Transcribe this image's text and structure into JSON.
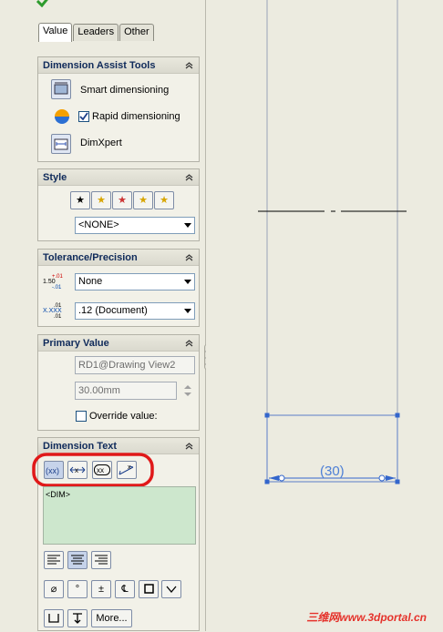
{
  "tabs": [
    {
      "label": "Value",
      "active": true
    },
    {
      "label": "Leaders",
      "active": false
    },
    {
      "label": "Other",
      "active": false
    }
  ],
  "panels": {
    "dimension_assist": {
      "title": "Dimension Assist Tools",
      "items": [
        "Smart dimensioning",
        "Rapid dimensioning",
        "DimXpert"
      ],
      "rapid_checked": true
    },
    "style": {
      "title": "Style",
      "selected": "<NONE>"
    },
    "tolerance": {
      "title": "Tolerance/Precision",
      "tolerance_type": "None",
      "precision": ".12 (Document)"
    },
    "primary_value": {
      "title": "Primary Value",
      "reference": "RD1@Drawing View2",
      "value": "30.00mm",
      "override_label": "Override value:",
      "override_checked": false
    },
    "dimension_text": {
      "title": "Dimension Text",
      "text": "<DIM>",
      "more_label": "More..."
    }
  },
  "drawing": {
    "dim_label": "(30)"
  },
  "watermark": "三维网www.3dportal.cn"
}
